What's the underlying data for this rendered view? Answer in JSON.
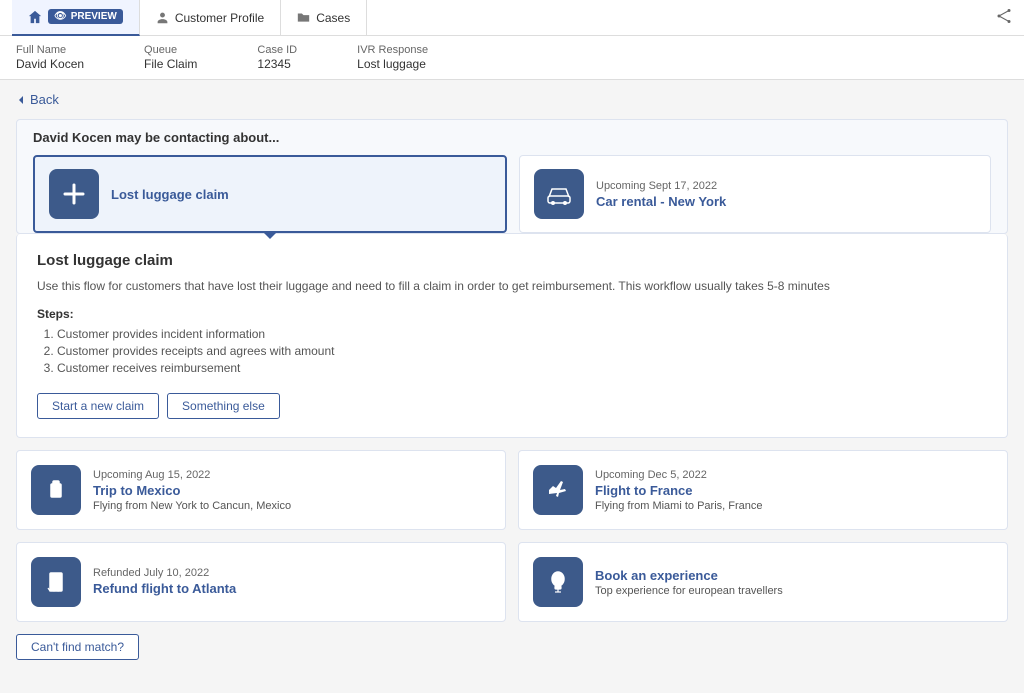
{
  "nav": {
    "tabs": [
      {
        "id": "home",
        "label": "PREVIEW",
        "active": true,
        "icon": "home"
      },
      {
        "id": "customer-profile",
        "label": "Customer Profile",
        "active": false,
        "icon": "person"
      },
      {
        "id": "cases",
        "label": "Cases",
        "active": false,
        "icon": "folder"
      }
    ],
    "share_icon": "share"
  },
  "info_bar": {
    "fields": [
      {
        "label": "Full Name",
        "value": "David Kocen"
      },
      {
        "label": "Queue",
        "value": "File Claim"
      },
      {
        "label": "Case ID",
        "value": "12345"
      },
      {
        "label": "IVR Response",
        "value": "Lost luggage"
      }
    ]
  },
  "back_label": "Back",
  "contact_header": "David Kocen may be contacting about...",
  "main_cards": [
    {
      "id": "lost-luggage",
      "selected": true,
      "icon": "plus",
      "date": "",
      "title": "Lost luggage claim"
    },
    {
      "id": "car-rental",
      "selected": false,
      "icon": "car",
      "date": "Upcoming Sept 17, 2022",
      "title": "Car rental - New York"
    }
  ],
  "detail": {
    "title": "Lost luggage claim",
    "description": "Use this flow for customers that have lost their luggage and need to fill a claim in order to get reimbursement. This workflow usually takes 5-8 minutes",
    "steps_label": "Steps:",
    "steps": [
      "Customer provides incident information",
      "Customer provides receipts and agrees with amount",
      "Customer receives reimbursement"
    ],
    "buttons": [
      {
        "id": "start-new-claim",
        "label": "Start a new claim"
      },
      {
        "id": "something-else",
        "label": "Something else"
      }
    ]
  },
  "bottom_cards": [
    {
      "id": "trip-mexico",
      "icon": "luggage",
      "date": "Upcoming Aug 15, 2022",
      "title": "Trip to Mexico",
      "subtitle": "Flying from New York to Cancun, Mexico"
    },
    {
      "id": "flight-france",
      "icon": "plane",
      "date": "Upcoming Dec 5, 2022",
      "title": "Flight to France",
      "subtitle": "Flying from Miami to Paris, France"
    },
    {
      "id": "refund-atlanta",
      "icon": "receipt",
      "date": "Refunded July 10, 2022",
      "title": "Refund flight to Atlanta",
      "subtitle": ""
    },
    {
      "id": "book-experience",
      "icon": "balloon",
      "date": "",
      "title": "Book an experience",
      "subtitle": "Top experience for european travellers"
    }
  ],
  "cant_find_label": "Can't find match?"
}
